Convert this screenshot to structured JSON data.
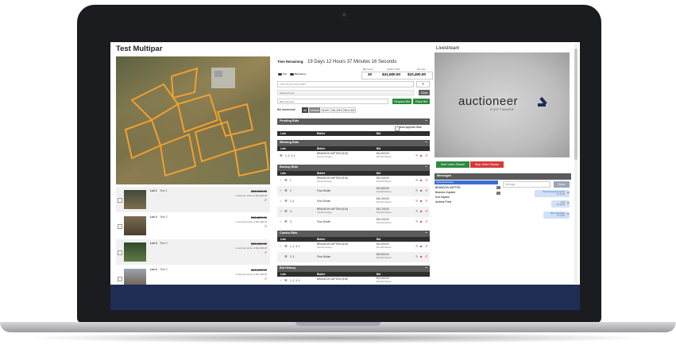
{
  "title": "Test Multipar",
  "timer": {
    "label": "Time Remaining:",
    "value": "19 Days 12 Hours 37 Minutes 16 Seconds"
  },
  "stats": {
    "bid_count": {
      "label": "Bid Count",
      "value": "20"
    },
    "auction_total": {
      "label": "Auction Total",
      "value": "$41,600.00"
    },
    "per_acre": {
      "label": "Per Acre",
      "value": "$10,400.00"
    }
  },
  "toggles": {
    "info": "Info",
    "bid_history": "Bid History"
  },
  "search": {
    "placeholder": "View bid as floor bidder"
  },
  "selected_lots": {
    "label": "Selected Lots",
    "clear": "Clear"
  },
  "bid_amount": {
    "label": "Bid Amount $",
    "request": "Request Bid",
    "place": "Place Bid"
  },
  "increments": {
    "label": "Bid Increments",
    "options": [
      "All",
      "Default",
      "$100",
      "$1,000",
      "$10,000"
    ]
  },
  "pending": {
    "title": "Pending Bids",
    "auto_approve": "Auto-Approve Bids",
    "cols": [
      "Lots",
      "Bidder",
      "Bid"
    ]
  },
  "winning": {
    "title": "Winning Bids",
    "cols": [
      "Lots",
      "Bidder",
      "Bid"
    ],
    "rows": [
      {
        "lots": "1, 2, 3, 4",
        "bidder": "BRANDON KAPTEIN (518)",
        "sub": "Seesha Vintage",
        "bid": "$41,600.00",
        "bid_sub": "$41,600.00/acre"
      }
    ]
  },
  "backup": {
    "title": "Backup Bids",
    "cols": [
      "Lots",
      "Bidder",
      "Bid"
    ],
    "rows": [
      {
        "lots": "1",
        "bidder": "BRANDON KAPTEIN (518)",
        "sub": "Seesha Vintage",
        "bid": "$10,000.00",
        "bid_sub": "$10,000.00/acre"
      },
      {
        "lots": "2",
        "bidder": "Floor Bidder",
        "sub": "",
        "bid": "$10,800.00",
        "bid_sub": "$10,800.00/acre"
      },
      {
        "lots": "2, 4",
        "bidder": "Floor Bidder",
        "sub": "",
        "bid": "$20,400.00",
        "bid_sub": "$20,400.00/acre"
      },
      {
        "lots": "4",
        "bidder": "BRANDON KAPTEIN (518)",
        "sub": "Seesha Vintage",
        "bid": "$10,100.00",
        "bid_sub": "$10,100.00/acre"
      },
      {
        "lots": "3",
        "bidder": "Floor Bidder",
        "sub": "",
        "bid": "$10,000.00",
        "bid_sub": "$10,000.00/acre"
      }
    ]
  },
  "combo": {
    "title": "Combo Bids",
    "cols": [
      "Lots",
      "Bidder",
      "Bid"
    ],
    "rows": [
      {
        "lots": "1, 2, 3, 4",
        "bidder": "BRANDON KAPTEIN (518)",
        "sub": "Seesha Vintage",
        "bid": "$41,600.00",
        "bid_sub": "$41,600.00/acre"
      },
      {
        "lots": "2, 3",
        "bidder": "Floor Bidder",
        "sub": "",
        "bid": "$20,800.00",
        "bid_sub": "$20,800.00/acre"
      }
    ]
  },
  "history": {
    "title": "Bid History",
    "cols": [
      "Lots",
      "Bidder",
      "Bid"
    ],
    "rows": [
      {
        "lots": "1, 2, 3, 4",
        "bidder": "BRANDON KAPTEIN (518)",
        "bid": "$41,600.00",
        "bid_sub": "$41,600.00/acre"
      }
    ]
  },
  "lots": [
    {
      "name": "Lot 1",
      "desc": "Test 1",
      "price": "$10,000.00",
      "note": "in winning combo of $41,600.00"
    },
    {
      "name": "Lot 2",
      "desc": "Test 2",
      "price": "$10,800.00",
      "note": "in winning combo of $41,600.00"
    },
    {
      "name": "Lot 3",
      "desc": "Test 2",
      "price": "$10,000.00",
      "note": "in winning combo of $41,600.00"
    },
    {
      "name": "Lot 4",
      "desc": "Test 2",
      "price": "$10,100.00",
      "note": "in winning combo of $41,600.00"
    }
  ],
  "livestream": {
    "title": "Livestream",
    "brand": "auctioneer",
    "brand_sub": "S O F T W A R E",
    "start": "Start Video Stream",
    "stop": "Stop Video Stream"
  },
  "messages": {
    "title": "Messages",
    "announcements": "Announcements",
    "users": [
      "BRANDON KAPTEN",
      "Brandon Kaptein",
      "Kurt Kapten",
      "Andrew Prins"
    ],
    "input_placeholder": "Message",
    "send": "Send",
    "bubbles": [
      {
        "text": "Test Announcements",
        "time": "11:22 AM"
      },
      {
        "text": "test",
        "time": "11:46 AM"
      },
      {
        "text": "Test message",
        "time": "11:44 AM"
      }
    ]
  },
  "colors": {
    "accent": "#2b8a3e",
    "danger": "#d83a3a",
    "header": "#5b5b5b",
    "footer": "#1f2d55",
    "highlight": "#f0b429"
  }
}
